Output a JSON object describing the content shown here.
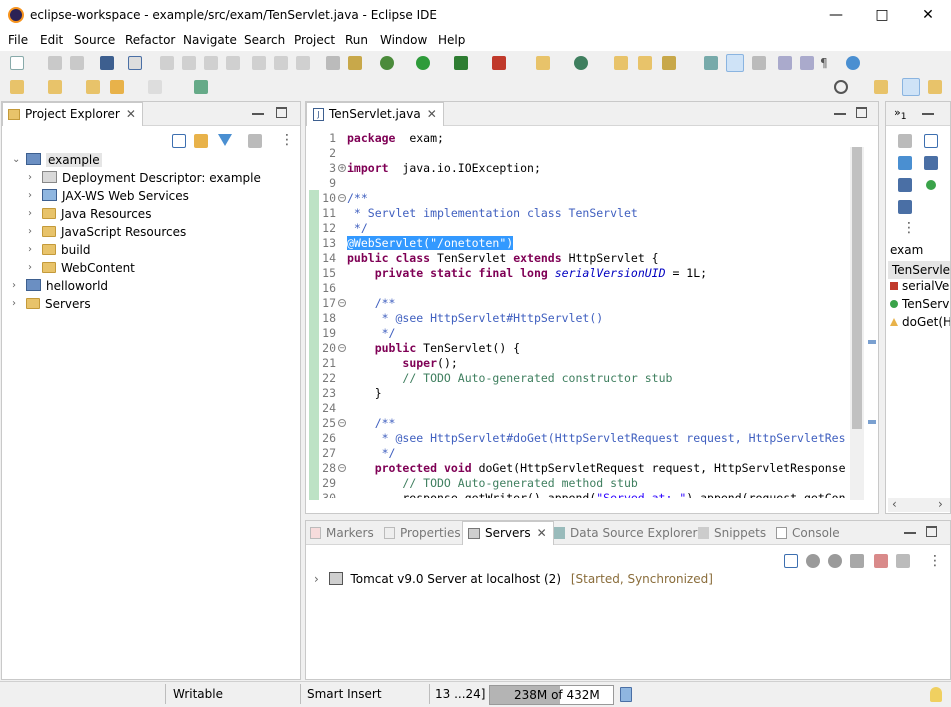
{
  "window": {
    "title": "eclipse-workspace - example/src/exam/TenServlet.java - Eclipse IDE"
  },
  "menu": [
    "File",
    "Edit",
    "Source",
    "Refactor",
    "Navigate",
    "Search",
    "Project",
    "Run",
    "Window",
    "Help"
  ],
  "project_explorer": {
    "tab_label": "Project Explorer",
    "tree": [
      {
        "label": "example",
        "depth": 0,
        "expanded": true,
        "selected": true,
        "icon": "project-icon"
      },
      {
        "label": "Deployment Descriptor: example",
        "depth": 1,
        "icon": "deployment-descriptor-icon"
      },
      {
        "label": "JAX-WS Web Services",
        "depth": 1,
        "icon": "web-services-icon"
      },
      {
        "label": "Java Resources",
        "depth": 1,
        "icon": "java-resources-icon"
      },
      {
        "label": "JavaScript Resources",
        "depth": 1,
        "icon": "javascript-resources-icon"
      },
      {
        "label": "build",
        "depth": 1,
        "icon": "folder-icon"
      },
      {
        "label": "WebContent",
        "depth": 1,
        "icon": "folder-icon"
      },
      {
        "label": "helloworld",
        "depth": 0,
        "icon": "project-icon"
      },
      {
        "label": "Servers",
        "depth": 0,
        "icon": "folder-icon"
      }
    ]
  },
  "editor": {
    "tab_label": "TenServlet.java",
    "lines": [
      {
        "n": "1",
        "html": [
          [
            "kw",
            "package"
          ],
          [
            "",
            "  exam;"
          ]
        ]
      },
      {
        "n": "2",
        "html": []
      },
      {
        "n": "3",
        "html": [
          [
            "kw",
            "import"
          ],
          [
            "",
            "  java.io.IOException;"
          ]
        ]
      },
      {
        "n": "9",
        "html": []
      },
      {
        "n": "10",
        "html": [
          [
            "jd",
            "/**"
          ]
        ]
      },
      {
        "n": "11",
        "html": [
          [
            "jd",
            " * Servlet implementation class TenServlet"
          ]
        ]
      },
      {
        "n": "12",
        "html": [
          [
            "jd",
            " */"
          ]
        ]
      },
      {
        "n": "13",
        "html": [
          [
            "an",
            "@WebServlet"
          ],
          [
            "",
            "("
          ],
          [
            "st",
            "\"/onetoten\""
          ],
          [
            "",
            ")"
          ]
        ]
      },
      {
        "n": "14",
        "html": [
          [
            "kw",
            "public class"
          ],
          [
            "",
            " TenServlet "
          ],
          [
            "kw",
            "extends"
          ],
          [
            "",
            " HttpServlet {"
          ]
        ]
      },
      {
        "n": "15",
        "html": [
          [
            "",
            "    "
          ],
          [
            "kw",
            "private static final long"
          ],
          [
            "",
            " "
          ],
          [
            "fi",
            "serialVersionUID"
          ],
          [
            "",
            " = 1L;"
          ]
        ]
      },
      {
        "n": "16",
        "html": []
      },
      {
        "n": "17",
        "html": [
          [
            "",
            "    "
          ],
          [
            "jd",
            "/**"
          ]
        ]
      },
      {
        "n": "18",
        "html": [
          [
            "",
            "    "
          ],
          [
            "jd",
            " * @see HttpServlet#HttpServlet()"
          ]
        ]
      },
      {
        "n": "19",
        "html": [
          [
            "",
            "    "
          ],
          [
            "jd",
            " */"
          ]
        ]
      },
      {
        "n": "20",
        "html": [
          [
            "",
            "    "
          ],
          [
            "kw",
            "public"
          ],
          [
            "",
            " TenServlet() {"
          ]
        ]
      },
      {
        "n": "21",
        "html": [
          [
            "",
            "        "
          ],
          [
            "kw",
            "super"
          ],
          [
            "",
            "();"
          ]
        ]
      },
      {
        "n": "22",
        "html": [
          [
            "",
            "        "
          ],
          [
            "cm",
            "// TODO Auto-generated constructor stub"
          ]
        ]
      },
      {
        "n": "23",
        "html": [
          [
            "",
            "    }"
          ]
        ]
      },
      {
        "n": "24",
        "html": []
      },
      {
        "n": "25",
        "html": [
          [
            "",
            "    "
          ],
          [
            "jd",
            "/**"
          ]
        ]
      },
      {
        "n": "26",
        "html": [
          [
            "",
            "    "
          ],
          [
            "jd",
            " * @see HttpServlet#doGet(HttpServletRequest request, HttpServletRes"
          ]
        ]
      },
      {
        "n": "27",
        "html": [
          [
            "",
            "    "
          ],
          [
            "jd",
            " */"
          ]
        ]
      },
      {
        "n": "28",
        "html": [
          [
            "",
            "    "
          ],
          [
            "kw",
            "protected void"
          ],
          [
            "",
            " doGet(HttpServletRequest request, HttpServletResponse"
          ]
        ]
      },
      {
        "n": "29",
        "html": [
          [
            "",
            "        "
          ],
          [
            "cm",
            "// TODO Auto-generated method stub"
          ]
        ]
      },
      {
        "n": "30",
        "html": [
          [
            "",
            "        response.getWriter().append("
          ],
          [
            "st",
            "\"Served at: \""
          ],
          [
            "",
            ").append(request.getCon"
          ]
        ]
      }
    ]
  },
  "outline": {
    "package": "exam",
    "items": [
      "TenServlet",
      "serialVe",
      "TenServ",
      "doGet(H"
    ]
  },
  "bottom": {
    "tabs": [
      "Markers",
      "Properties",
      "Servers",
      "Data Source Explorer",
      "Snippets",
      "Console"
    ],
    "active_tab": "Servers",
    "server_name": "Tomcat v9.0 Server at localhost",
    "server_count": "(2)",
    "server_state": "[Started, Synchronized]"
  },
  "status": {
    "writable": "Writable",
    "insert_mode": "Smart Insert",
    "position": "13 ...24]",
    "heap_used": "238M",
    "heap_of": "of",
    "heap_total": "432M"
  },
  "colors": {
    "selection": "#0078d7",
    "accent": "#2a5fb0",
    "heap_bar": "#b4b4b4"
  }
}
